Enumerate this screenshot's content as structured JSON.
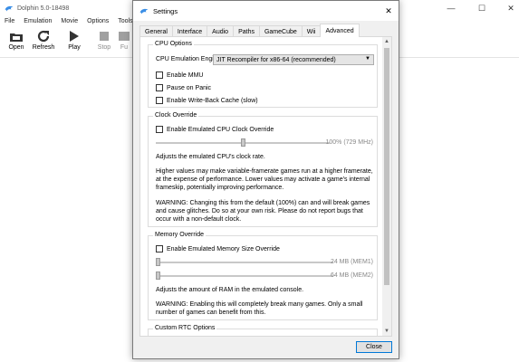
{
  "main_window": {
    "title": "Dolphin 5.0-18498",
    "menu": [
      "File",
      "Emulation",
      "Movie",
      "Options",
      "Tools"
    ],
    "toolbar": [
      {
        "label": "Open",
        "icon": "folder-icon",
        "enabled": true
      },
      {
        "label": "Refresh",
        "icon": "refresh-icon",
        "enabled": true
      },
      {
        "label": "Play",
        "icon": "play-icon",
        "enabled": true
      },
      {
        "label": "Stop",
        "icon": "stop-icon",
        "enabled": false
      },
      {
        "label": "Fu",
        "icon": "fullscreen-icon",
        "enabled": false
      }
    ],
    "controls": {
      "minimize": "—",
      "maximize": "☐",
      "close": "✕"
    }
  },
  "dialog": {
    "title": "Settings",
    "close_glyph": "✕",
    "tabs": [
      "General",
      "Interface",
      "Audio",
      "Paths",
      "GameCube",
      "Wii",
      "Advanced"
    ],
    "active_tab": "Advanced",
    "close_button": "Close"
  },
  "cpu_options": {
    "title": "CPU Options",
    "engine_label": "CPU Emulation Engine:",
    "engine_value": "JIT Recompiler for x86-64 (recommended)",
    "enable_mmu": "Enable MMU",
    "pause_on_panic": "Pause on Panic",
    "write_back_cache": "Enable Write-Back Cache (slow)"
  },
  "clock_override": {
    "title": "Clock Override",
    "checkbox": "Enable Emulated CPU Clock Override",
    "slider_value": "100% (729 MHz)",
    "slider_fraction": 0.5,
    "desc1": "Adjusts the emulated CPU's clock rate.",
    "desc2": "Higher values may make variable-framerate games run at a higher framerate, at the expense of performance. Lower values may activate a game's internal frameskip, potentially improving performance.",
    "desc3": "WARNING: Changing this from the default (100%) can and will break games and cause glitches. Do so at your own risk. Please do not report bugs that occur with a non-default clock."
  },
  "memory_override": {
    "title": "Memory Override",
    "checkbox": "Enable Emulated Memory Size Override",
    "mem1_value": "24 MB (MEM1)",
    "mem2_value": "64 MB (MEM2)",
    "mem1_fraction": 0.0,
    "mem2_fraction": 0.0,
    "desc1": "Adjusts the amount of RAM in the emulated console.",
    "desc2": "WARNING: Enabling this will completely break many games. Only a small number of games can benefit from this."
  },
  "rtc_options": {
    "title": "Custom RTC Options"
  },
  "colors": {
    "accent": "#0078d7",
    "scroll_thumb": "#c1c1c1"
  }
}
